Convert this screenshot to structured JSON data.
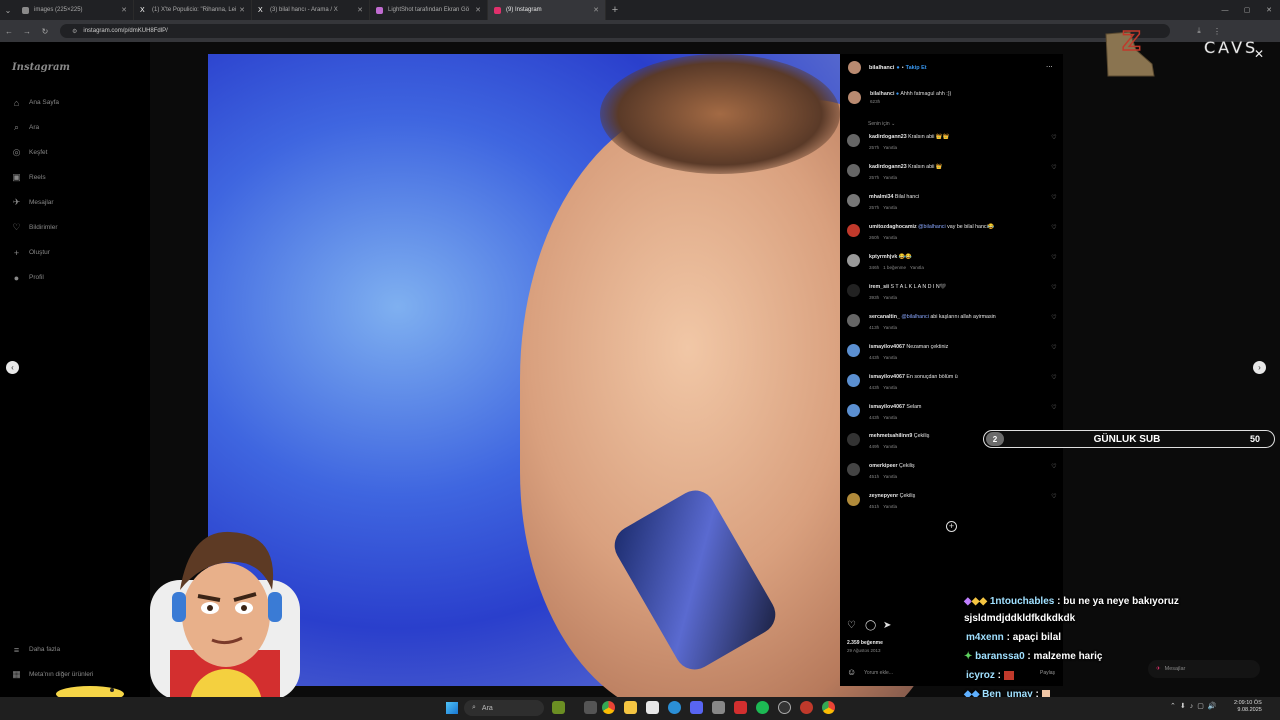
{
  "browser": {
    "tabs": [
      {
        "title": "images (225×225)",
        "color": "#8a8a8a"
      },
      {
        "title": "(1) X'te Populicio: \"Rihanna, Lei",
        "color": "#ffffff"
      },
      {
        "title": "(3) bilal hancı - Arama / X",
        "color": "#ffffff"
      },
      {
        "title": "LightShot tarafından Ekran Gö",
        "color": "#c06bd0"
      },
      {
        "title": "(9) Instagram",
        "color": "#e1306c"
      }
    ],
    "url": "instagram.com/p/dmKUH8FdlP/",
    "new_tab": "+"
  },
  "instagram": {
    "logo": "Instagram",
    "nav": [
      {
        "label": "Ana Sayfa",
        "icon": "home-icon",
        "glyph": "⌂"
      },
      {
        "label": "Ara",
        "icon": "search-icon",
        "glyph": "⌕"
      },
      {
        "label": "Keşfet",
        "icon": "compass-icon",
        "glyph": "◎"
      },
      {
        "label": "Reels",
        "icon": "reels-icon",
        "glyph": "▣"
      },
      {
        "label": "Mesajlar",
        "icon": "messenger-icon",
        "glyph": "✈"
      },
      {
        "label": "Bildirimler",
        "icon": "heart-icon",
        "glyph": "♡"
      },
      {
        "label": "Oluştur",
        "icon": "plus-icon",
        "glyph": "+"
      },
      {
        "label": "Profil",
        "icon": "profile-icon",
        "glyph": "●"
      }
    ],
    "more": "Daha fazla",
    "meta": "Meta'nın diğer ürünleri"
  },
  "post": {
    "author": "bilalhanci",
    "follow": "Takip Et",
    "more": "...",
    "caption_user": "bilalhanci",
    "caption": "Ahhh fatmagul ahh :))",
    "caption_time": "623h",
    "sort": "Senin için",
    "comments": [
      {
        "user": "kadirdogann23",
        "text": "Kralsın abii 👑👑",
        "time": "257h",
        "reply": "Yanıtla",
        "likes": ""
      },
      {
        "user": "kadirdogann23",
        "text": "Kralsın abii 👑",
        "time": "257h",
        "reply": "Yanıtla",
        "likes": ""
      },
      {
        "user": "mhalmi34",
        "text": "Bilal hanci",
        "time": "257h",
        "reply": "Yanıtla",
        "likes": ""
      },
      {
        "user": "umitozdaghocamiz",
        "mention": "@bilalhanci",
        "text": "vay be bilal hanci😂",
        "time": "260h",
        "reply": "Yanıtla",
        "likes": ""
      },
      {
        "user": "kptyrmhjvk",
        "text": "😂😂",
        "time": "346h",
        "reply": "Yanıtla",
        "likes": "1 beğenme"
      },
      {
        "user": "irem_sii",
        "text": "S T A L K L A N D I N🖤",
        "time": "393h",
        "reply": "Yanıtla",
        "likes": ""
      },
      {
        "user": "sercanaltin_",
        "mention": "@bilalhanci",
        "text": "abi kaşlarını allah ayirmasin",
        "time": "413h",
        "reply": "Yanıtla",
        "likes": ""
      },
      {
        "user": "ismayilov4067",
        "text": "Nezaman çektiniz",
        "time": "443h",
        "reply": "Yanıtla",
        "likes": ""
      },
      {
        "user": "ismayilov4067",
        "text": "En sonuçdan bölüm ü",
        "time": "443h",
        "reply": "Yanıtla",
        "likes": ""
      },
      {
        "user": "ismayilov4067",
        "text": "Selam",
        "time": "443h",
        "reply": "Yanıtla",
        "likes": ""
      },
      {
        "user": "mehmetsahilinn9",
        "text": "Çekiliş",
        "time": "449h",
        "reply": "Yanıtla",
        "likes": ""
      },
      {
        "user": "omerkipeer",
        "text": "Çekiliş",
        "time": "451h",
        "reply": "Yanıtla",
        "likes": ""
      },
      {
        "user": "zeynepyenr",
        "text": "Çekiliş",
        "time": "451h",
        "reply": "Yanıtla",
        "likes": ""
      }
    ],
    "likes": "2.359 beğenme",
    "date": "29 Ağustos 2013",
    "comment_placeholder": "Yorum ekle...",
    "share": "Paylaş"
  },
  "overlay": {
    "sub_count": "2",
    "sub_label": "GÜNLUK SUB",
    "sub_goal": "50",
    "brand": "CAVS",
    "chat": [
      {
        "user": "1ntouchables",
        "msg": "bu ne ya neye bakıyoruz"
      },
      {
        "user": "",
        "msg": "sjsldmdjddkldfkdkdkdk"
      },
      {
        "user": "m4xenn",
        "msg": "apaçi bilal"
      },
      {
        "user": "baranssa0",
        "msg": "malzeme hariç"
      },
      {
        "user": "icyroz",
        "msg": ""
      },
      {
        "user": "Ben_umay",
        "msg": ""
      }
    ],
    "messages_pill": "Mesajlar"
  },
  "taskbar": {
    "search": "Ara",
    "time": "2:09:10 ÖS",
    "date": "9.08.2025"
  }
}
